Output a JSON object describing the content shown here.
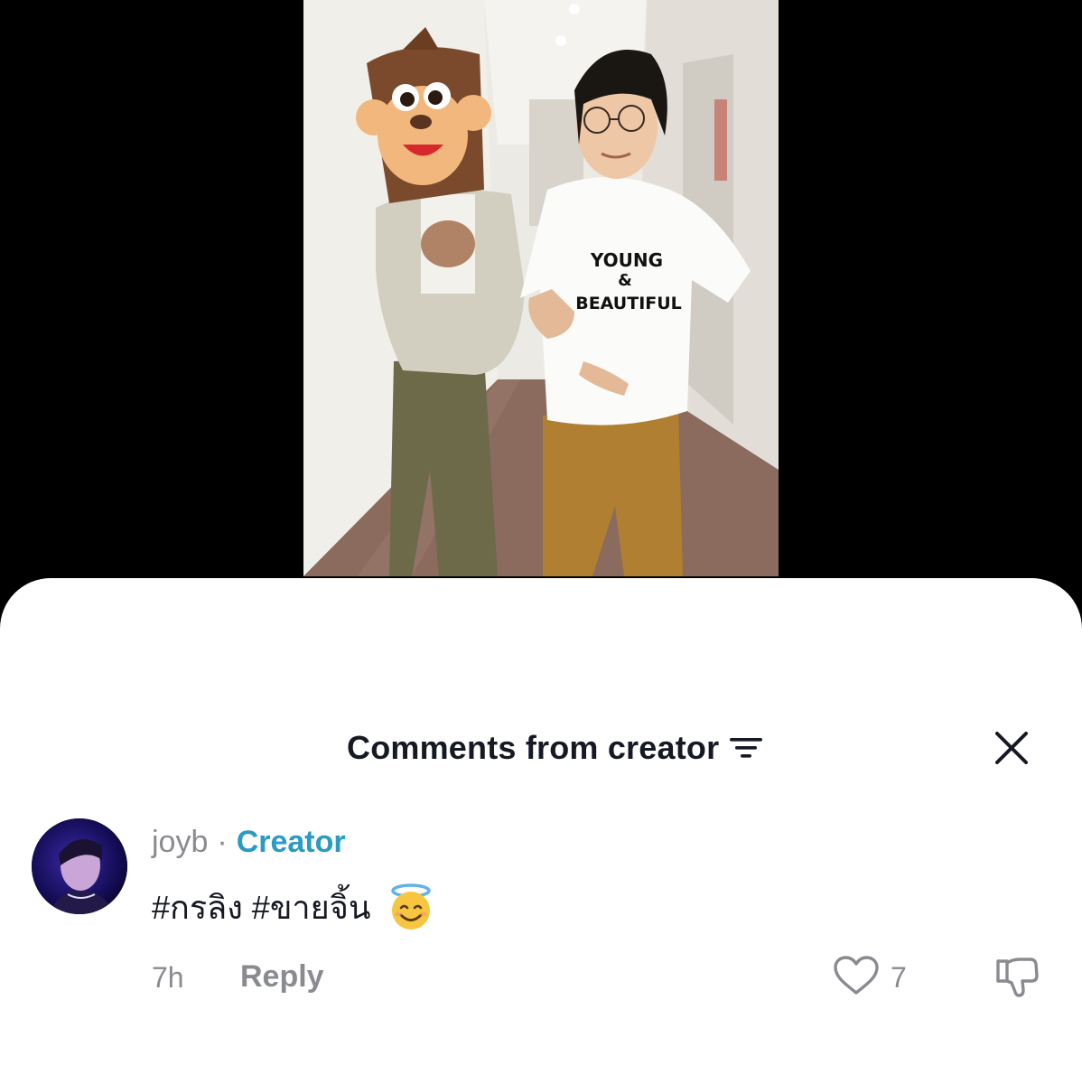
{
  "video": {
    "shirt_text_line1": "YOUNG",
    "shirt_text_line2": "&",
    "shirt_text_line3": "BEAUTIFUL"
  },
  "sheet": {
    "title": "Comments from creator",
    "filter_icon": "filter-lines-icon",
    "close_icon": "close-x-icon"
  },
  "comment": {
    "username": "joyb",
    "separator": "·",
    "badge": "Creator",
    "text": "#กรลิง #ขายจิ้น",
    "emoji": "smiling-face-with-halo",
    "time": "7h",
    "reply_label": "Reply",
    "likes": "7",
    "like_icon": "heart-outline-icon",
    "dislike_icon": "thumbs-down-icon"
  },
  "colors": {
    "text_primary": "#161823",
    "text_secondary": "#8a8b91",
    "creator_accent": "#2a9bc2",
    "sheet_bg": "#ffffff",
    "backdrop": "#000000"
  }
}
